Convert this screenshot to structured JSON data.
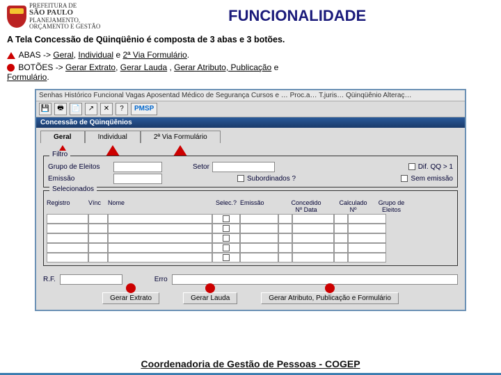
{
  "logo": {
    "l1": "PREFEITURA DE",
    "l2": "SÃO PAULO",
    "l3": "PLANEJAMENTO,",
    "l4": "ORÇAMENTO E GESTÃO"
  },
  "title": "FUNCIONALIDADE",
  "intro": "A Tela Concessão de Qüinqüênio é composta de 3 abas e 3 botões.",
  "abas": {
    "label": "ABAS ->",
    "items": [
      "Geral",
      "Individual",
      "2ª Via Formulário"
    ],
    "e": "e",
    "dot": "."
  },
  "botoes": {
    "label": "BOTÕES ->",
    "items": [
      "Gerar Extrato",
      "Gerar Lauda",
      "Gerar Atributo, Publicação",
      "Formulário"
    ],
    "e": "e",
    "dot": "."
  },
  "app": {
    "menubar": "Senhas   Histórico Funcional   Vagas   Aposentad   Médico de Segurança   Cursos e …   Proc.a…   T.juris…   Qüinqüênio   Alteraç…",
    "toolbar_pmsp": "PMSP",
    "winbar": "Concessão de Qüinqüênios",
    "tabs": [
      "Geral",
      "Individual",
      "2ª Via Formulário"
    ],
    "filter": {
      "legend": "Filtro",
      "grupo": "Grupo de Eleitos",
      "setor": "Setor",
      "emissao": "Emissão",
      "sub": "Subordinados ?",
      "dif": "Dif. QQ > 1",
      "sem": "Sem emissão"
    },
    "sel": {
      "legend": "Selecionados",
      "h": {
        "reg": "Registro",
        "vinc": "Vínc",
        "nome": "Nome",
        "selec": "Selec.?",
        "emis": "Emissão",
        "conc": "Concedido",
        "conc2": "Nº     Data",
        "calc": "Calculado",
        "calc2": "Nº",
        "grupo": "Grupo de",
        "grupo2": "Eleitos"
      }
    },
    "rf": "R.F.",
    "erro": "Erro",
    "buttons": [
      "Gerar Extrato",
      "Gerar Lauda",
      "Gerar Atributo, Publicação e Formulário"
    ]
  },
  "footer": "Coordenadoria de Gestão de Pessoas - COGEP"
}
